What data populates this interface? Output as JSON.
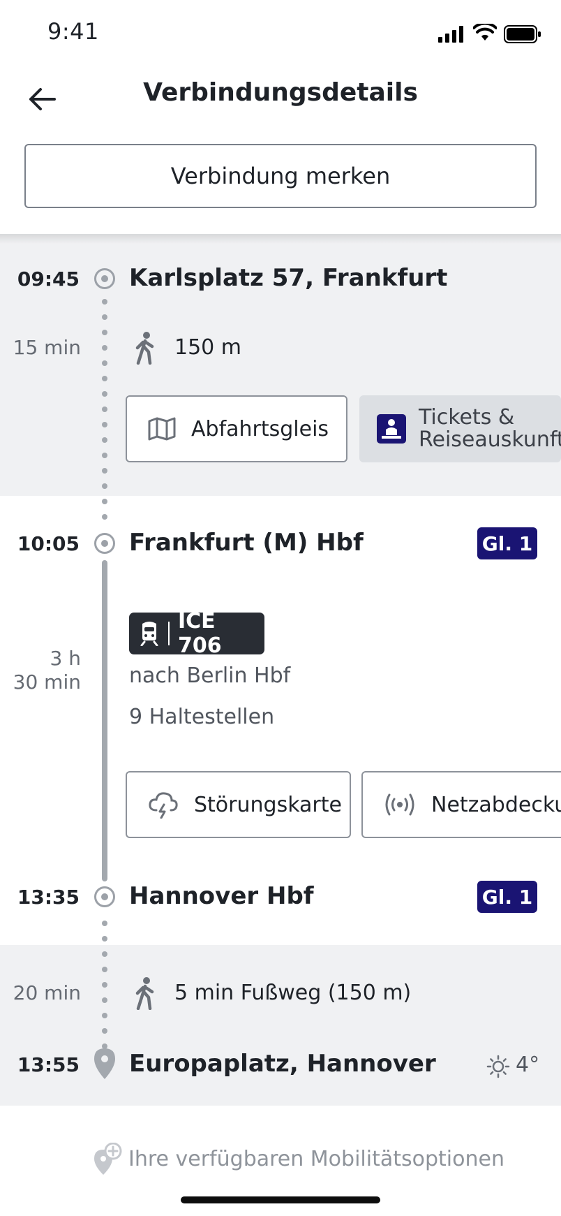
{
  "status_bar": {
    "time": "9:41"
  },
  "header": {
    "title": "Verbindungsdetails",
    "save_label": "Verbindung merken"
  },
  "journey": {
    "start": {
      "time": "09:45",
      "name": "Karlsplatz 57, Frankfurt"
    },
    "walk1": {
      "duration": "15 min",
      "distance": "150 m"
    },
    "buttons1": {
      "departure_platform": "Abfahrtsgleis",
      "tickets_line1": "Tickets &",
      "tickets_line2": "Reiseauskunft"
    },
    "stop2": {
      "time": "10:05",
      "name": "Frankfurt (M) Hbf",
      "platform": "Gl. 1"
    },
    "train": {
      "label": "ICE 706",
      "duration_line1": "3 h",
      "duration_line2": "30 min",
      "direction": "nach Berlin Hbf",
      "stops": "9 Haltestellen"
    },
    "buttons2": {
      "disruption_map": "Störungskarte",
      "network": "Netzabdeckung"
    },
    "stop3": {
      "time": "13:35",
      "name": "Hannover Hbf",
      "platform": "Gl. 1"
    },
    "walk2": {
      "duration": "20 min",
      "text": "5 min Fußweg (150 m)"
    },
    "end": {
      "time": "13:55",
      "name": "Europaplatz, Hannover",
      "weather": "4°"
    }
  },
  "footer": {
    "mobility_options": "Ihre verfügbaren Mobilitätsoptionen"
  },
  "colors": {
    "platform_badge": "#1a1473",
    "train_badge": "#292d34",
    "section_grey": "#f0f1f3"
  },
  "icons": [
    "back-arrow-icon",
    "signal-icon",
    "wifi-icon",
    "battery-icon",
    "walk-icon",
    "map-icon",
    "ticket-counter-icon",
    "train-icon",
    "storm-icon",
    "broadcast-icon",
    "sun-icon",
    "location-pin-icon",
    "add-location-icon"
  ]
}
